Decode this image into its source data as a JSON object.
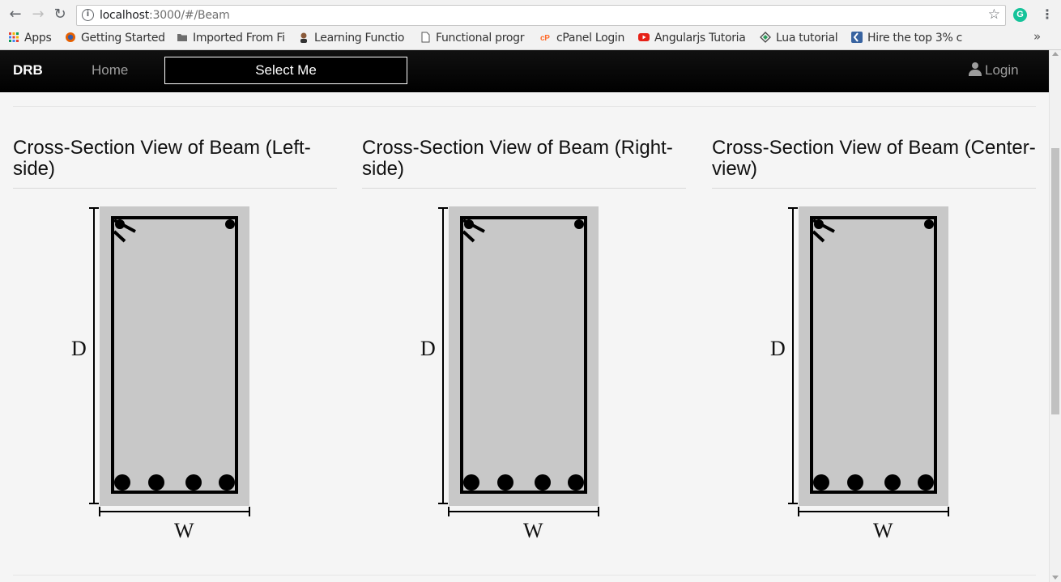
{
  "browser": {
    "url_host": "localhost",
    "url_path": ":3000/#/Beam",
    "bookmarks": [
      {
        "label": "Apps",
        "icon": "apps-grid-icon"
      },
      {
        "label": "Getting Started",
        "icon": "firefox-icon"
      },
      {
        "label": "Imported From Fi",
        "icon": "folder-icon"
      },
      {
        "label": "Learning Functio",
        "icon": "avatar-icon"
      },
      {
        "label": "Functional progr",
        "icon": "page-icon"
      },
      {
        "label": "cPanel Login",
        "icon": "cpanel-icon"
      },
      {
        "label": "Angularjs Tutoria",
        "icon": "youtube-icon"
      },
      {
        "label": "Lua tutorial",
        "icon": "diamond-icon"
      },
      {
        "label": "Hire the top 3% c",
        "icon": "toptal-icon"
      }
    ]
  },
  "navbar": {
    "brand": "DRB",
    "home": "Home",
    "select_button": "Select Me",
    "login": "Login"
  },
  "panels": [
    {
      "title": "Cross-Section View of Beam (Left-side)",
      "depth_label": "D",
      "width_label": "W"
    },
    {
      "title": "Cross-Section View of Beam (Right-side)",
      "depth_label": "D",
      "width_label": "W"
    },
    {
      "title": "Cross-Section View of Beam (Center-view)",
      "depth_label": "D",
      "width_label": "W"
    }
  ],
  "colors": {
    "navbar_bg": "#000000",
    "concrete": "#c8c8c8",
    "steel": "#000000"
  }
}
